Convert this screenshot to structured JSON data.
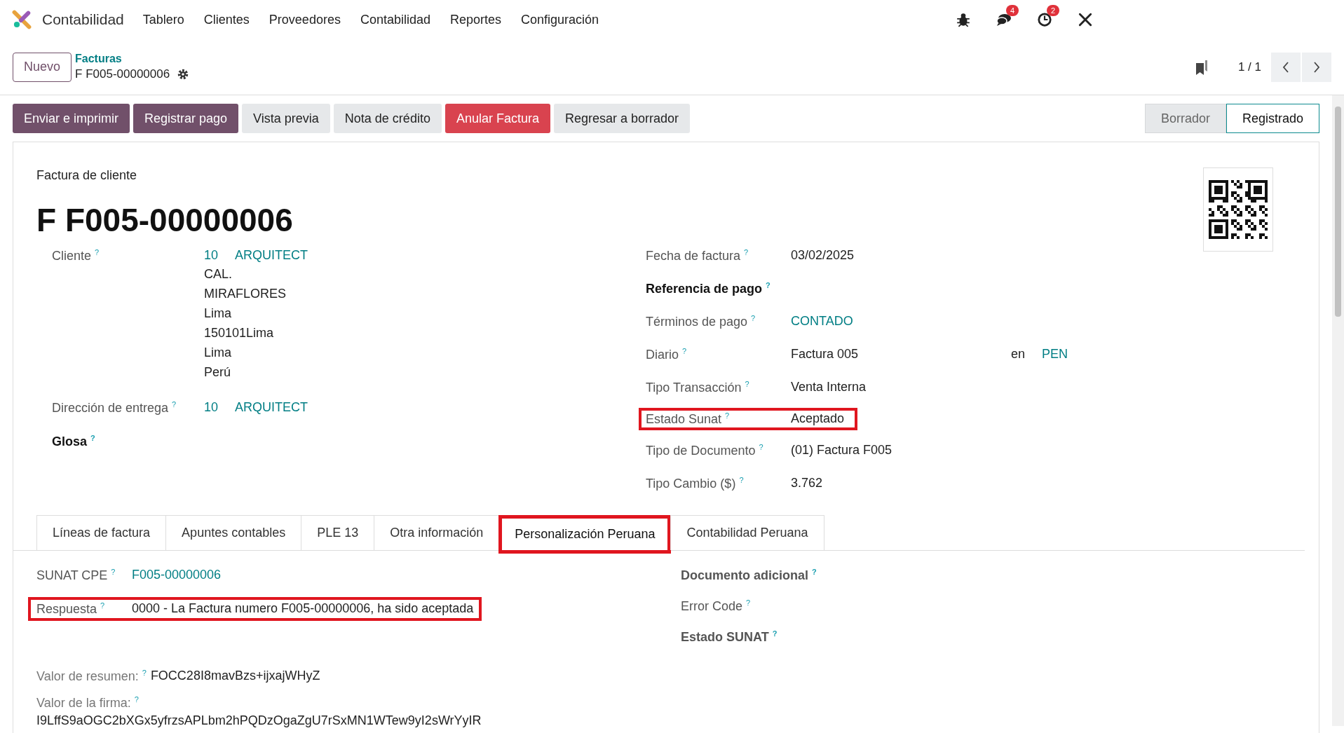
{
  "nav": {
    "app": "Contabilidad",
    "menu": [
      "Tablero",
      "Clientes",
      "Proveedores",
      "Contabilidad",
      "Reportes",
      "Configuración"
    ],
    "systray": [
      {
        "kind": "bug"
      },
      {
        "kind": "chat",
        "count": "4"
      },
      {
        "kind": "clock",
        "count": "2"
      },
      {
        "kind": "tools"
      }
    ]
  },
  "control_panel": {
    "new_button": "Nuevo",
    "parent": "Facturas",
    "current": "F F005-00000006",
    "pager": "1 / 1"
  },
  "actions": [
    {
      "label": "Enviar e imprimir",
      "kind": "primary"
    },
    {
      "label": "Registrar pago",
      "kind": "primary"
    },
    {
      "label": "Vista previa",
      "kind": "secondary"
    },
    {
      "label": "Nota de crédito",
      "kind": "secondary"
    },
    {
      "label": "Anular Factura",
      "kind": "danger"
    },
    {
      "label": "Regresar a borrador",
      "kind": "secondary"
    }
  ],
  "status": [
    {
      "label": "Borrador",
      "selected": false
    },
    {
      "label": "Registrado",
      "selected": true
    }
  ],
  "form": {
    "subtitle": "Factura de cliente",
    "title": "F F005-00000006",
    "left": [
      {
        "label": "Cliente $^{?}$",
        "strong": false,
        "highlighted": false,
        "values": [
          {
            "text": "10",
            "link": true
          },
          {
            "text": "ARQUITECT",
            "link": true
          }
        ],
        "lines": [
          "CAL.",
          "MIRAFLORES",
          "Lima",
          "150101Lima",
          "Lima",
          "Perú"
        ]
      },
      {
        "label": "Dirección de entrega $^{?}$",
        "strong": false,
        "highlighted": false,
        "values": [
          {
            "text": "10",
            "link": true
          },
          {
            "text": "ARQUITECT",
            "link": true
          }
        ]
      },
      {
        "label": "Glosa $^{?}$",
        "strong": true,
        "highlighted": false
      }
    ],
    "right": [
      {
        "label": "Fecha de factura $^{?}$",
        "strong": false,
        "highlighted": false,
        "values": [
          {
            "text": "03/02/2025",
            "link": false
          }
        ]
      },
      {
        "label": "Referencia de pago $^{?}$",
        "strong": true,
        "highlighted": false
      },
      {
        "label": "Términos de pago $^{?}$",
        "strong": false,
        "highlighted": false,
        "values": [
          {
            "text": "CONTADO",
            "link": true
          }
        ]
      },
      {
        "label": "Diario $^{?}$",
        "strong": false,
        "highlighted": false,
        "values": [
          {
            "text": "Factura 005",
            "link": false
          }
        ],
        "extra": {
          "prefix": "en",
          "value": "PEN"
        }
      },
      {
        "label": "Tipo Transacción $^{?}$",
        "strong": false,
        "highlighted": false,
        "values": [
          {
            "text": "Venta Interna",
            "link": false
          }
        ]
      },
      {
        "label": "Estado Sunat $^{?}$",
        "strong": false,
        "highlighted": true,
        "values": [
          {
            "text": "Aceptado",
            "link": false
          }
        ]
      },
      {
        "label": "Tipo de Documento $^{?}$",
        "strong": false,
        "highlighted": false,
        "values": [
          {
            "text": "(01) Factura F005",
            "link": false
          }
        ]
      },
      {
        "label": "Tipo Cambio ($) $^{?}$",
        "strong": false,
        "highlighted": false,
        "values": [
          {
            "text": "3.762",
            "link": false
          }
        ]
      }
    ]
  },
  "tabs": [
    {
      "label": "Líneas de factura",
      "selected": false,
      "highlighted": false
    },
    {
      "label": "Apuntes contables",
      "selected": false,
      "highlighted": false
    },
    {
      "label": "PLE 13",
      "selected": false,
      "highlighted": false
    },
    {
      "label": "Otra información",
      "selected": false,
      "highlighted": false
    },
    {
      "label": "Personalización Peruana",
      "selected": true,
      "highlighted": true
    },
    {
      "label": "Contabilidad Peruana",
      "selected": false,
      "highlighted": false
    }
  ],
  "tab_content": {
    "left": [
      {
        "label": "SUNAT CPE $^{?}$",
        "strong": false,
        "highlighted": false,
        "values": [
          {
            "text": "F005-00000006",
            "link": true
          }
        ]
      },
      {
        "label": "Respuesta $^{?}$",
        "strong": false,
        "highlighted": true,
        "values": [
          {
            "text": "0000 - La Factura numero F005-00000006, ha sido aceptada",
            "link": false
          }
        ]
      }
    ],
    "right": [
      {
        "label": "Documento adicional $^{?}$",
        "strong": true,
        "highlighted": false
      },
      {
        "label": "Error Code $^{?}$",
        "strong": false,
        "highlighted": false
      },
      {
        "label": "Estado SUNAT $^{?}$",
        "strong": true,
        "highlighted": false
      }
    ],
    "summary": {
      "label": "Valor de resumen: $^{?}$",
      "value": "FOCC28I8mavBzs+ijxajWHyZ"
    },
    "signature": {
      "label": "Valor de la firma: $^{?}$",
      "value": "I9LffS9aOGC2bXGx5yfrzsAPLbm2hPQDzOgaZgU7rSxMN1WTew9yI2sWrYyIR"
    }
  }
}
